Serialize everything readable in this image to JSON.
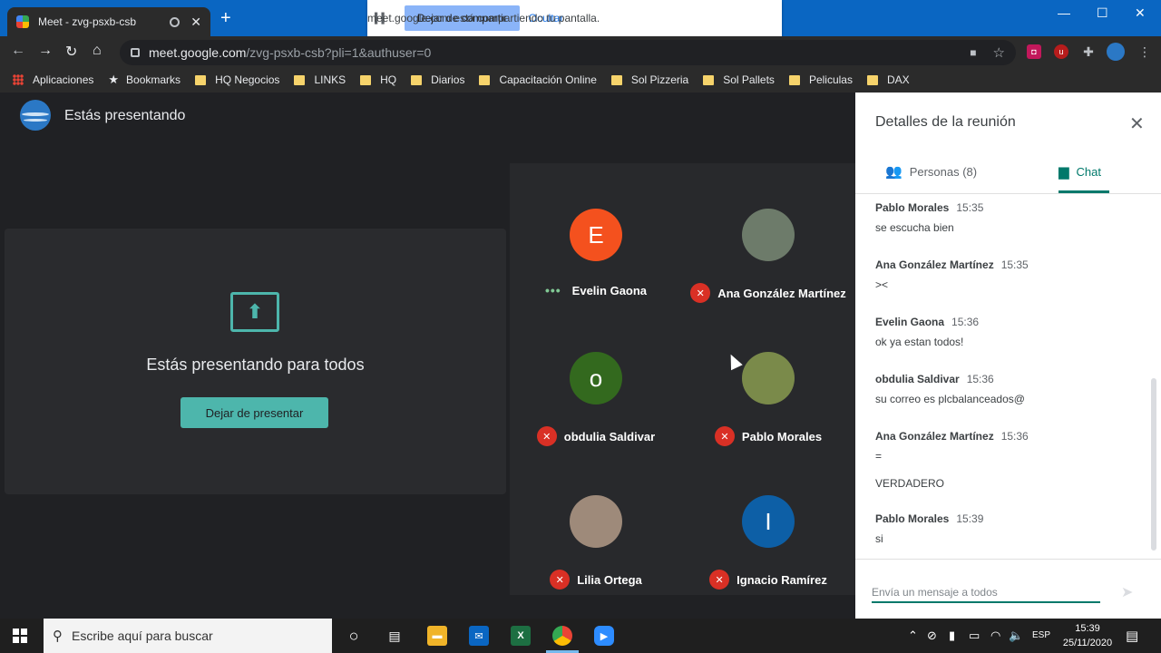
{
  "browser": {
    "tab_title": "Meet - zvg-psxb-csb",
    "new_tab": "+",
    "share_bar": {
      "message": "meet.google.com está compartiendo tu pantalla.",
      "stop_label": "Dejar de compartir",
      "hide_label": "Ocultar"
    },
    "url_host": "meet.google.com",
    "url_path": "/zvg-psxb-csb?pli=1&authuser=0",
    "bookmarks": [
      "Aplicaciones",
      "Bookmarks",
      "HQ Negocios",
      "LINKS",
      "HQ",
      "Diarios",
      "Capacitación Online",
      "Sol Pizzeria",
      "Sol Pallets",
      "Peliculas",
      "DAX"
    ]
  },
  "meet": {
    "presenting_title": "Estás presentando",
    "presenting_all": "Estás presentando para todos",
    "stop_presenting": "Dejar de presentar",
    "participants": [
      {
        "name": "Evelin Gaona",
        "initial": "E",
        "color": "#f4511e",
        "muted": false
      },
      {
        "name": "Ana González Martínez",
        "initial": "",
        "color": "#6d7b6a",
        "muted": true
      },
      {
        "name": "obdulia Saldivar",
        "initial": "o",
        "color": "#33691e",
        "muted": true
      },
      {
        "name": "Pablo Morales",
        "initial": "",
        "color": "#7a8a4a",
        "muted": true
      },
      {
        "name": "Lilia Ortega",
        "initial": "",
        "color": "#9e8a7a",
        "muted": true
      },
      {
        "name": "Ignacio Ramírez",
        "initial": "I",
        "color": "#0d5fa6",
        "muted": true
      }
    ]
  },
  "panel": {
    "title": "Detalles de la reunión",
    "tab_people": "Personas (8)",
    "tab_chat": "Chat",
    "messages": [
      {
        "sender": "Pablo Morales",
        "time": "15:35",
        "lines": [
          "se escucha bien"
        ]
      },
      {
        "sender": "Ana González Martínez",
        "time": "15:35",
        "lines": [
          "><"
        ]
      },
      {
        "sender": "Evelin Gaona",
        "time": "15:36",
        "lines": [
          "ok ya estan todos!"
        ]
      },
      {
        "sender": "obdulia Saldivar",
        "time": "15:36",
        "lines": [
          "su correo es plcbalanceados@"
        ]
      },
      {
        "sender": "Ana González Martínez",
        "time": "15:36",
        "lines": [
          "=",
          "VERDADERO"
        ]
      },
      {
        "sender": "Pablo Morales",
        "time": "15:39",
        "lines": [
          "si"
        ]
      }
    ],
    "composer_placeholder": "Envía un mensaje a todos"
  },
  "taskbar": {
    "search_placeholder": "Escribe aquí para buscar",
    "language": "ESP",
    "time": "15:39",
    "date": "25/11/2020"
  }
}
